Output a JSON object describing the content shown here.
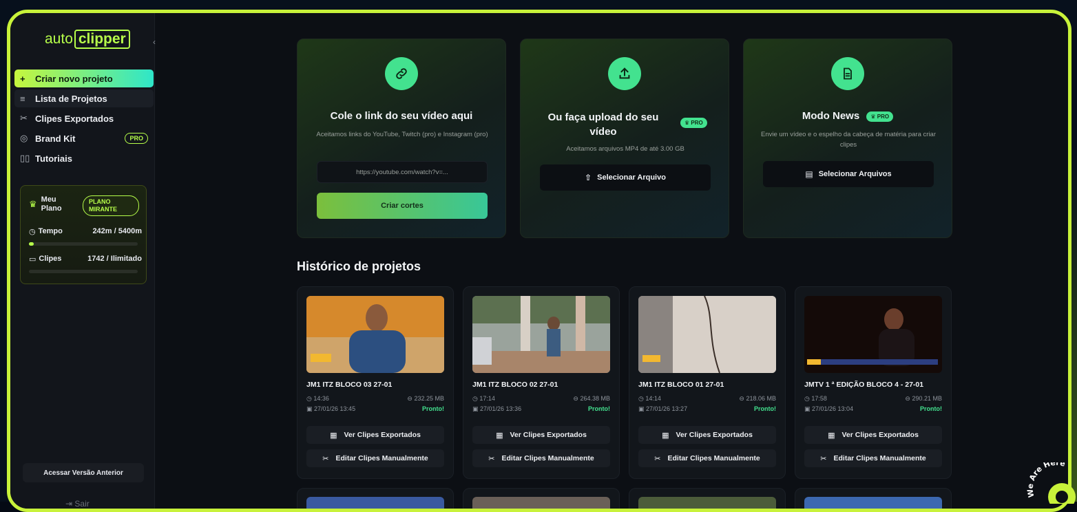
{
  "brand": {
    "logo_left": "auto",
    "logo_right": "clipper"
  },
  "sidebar": {
    "items": [
      {
        "icon": "plus-icon",
        "label": "Criar novo projeto"
      },
      {
        "icon": "list-icon",
        "label": "Lista de Projetos"
      },
      {
        "icon": "scissors-icon",
        "label": "Clipes Exportados"
      },
      {
        "icon": "palette-icon",
        "label": "Brand Kit",
        "badge": "PRO"
      },
      {
        "icon": "book-icon",
        "label": "Tutoriais"
      }
    ],
    "plan": {
      "label": "Meu Plano",
      "badge": "PLANO MIRANTE",
      "time_label": "Tempo",
      "time_value": "242m / 5400m",
      "time_fraction": 0.045,
      "clips_label": "Clipes",
      "clips_value": "1742 / Ilimitado",
      "clips_fraction": 0.0
    },
    "old_version": "Acessar Versão Anterior",
    "logout": "Sair"
  },
  "cards": {
    "link": {
      "title": "Cole o link do seu vídeo aqui",
      "subtitle": "Aceitamos links do YouTube, Twitch (pro) e Instagram (pro)",
      "placeholder": "https://youtube.com/watch?v=...",
      "button": "Criar cortes"
    },
    "upload": {
      "title": "Ou faça upload do seu vídeo",
      "badge": "PRO",
      "subtitle": "Aceitamos arquivos MP4 de até 3.00 GB",
      "button": "Selecionar Arquivo"
    },
    "news": {
      "title": "Modo News",
      "badge": "PRO",
      "subtitle": "Envie um vídeo e o espelho da cabeça de matéria para criar clipes",
      "button": "Selecionar Arquivos"
    }
  },
  "history": {
    "title": "Histórico de projetos",
    "projects": [
      {
        "title": "JM1 ITZ BLOCO 03 27-01",
        "duration": "14:36",
        "size": "232.25 MB",
        "date": "27/01/26 13:45",
        "status": "Pronto!",
        "btn_exported": "Ver Clipes Exportados",
        "btn_edit": "Editar Clipes Manualmente"
      },
      {
        "title": "JM1 ITZ BLOCO 02 27-01",
        "duration": "17:14",
        "size": "264.38 MB",
        "date": "27/01/26 13:36",
        "status": "Pronto!",
        "btn_exported": "Ver Clipes Exportados",
        "btn_edit": "Editar Clipes Manualmente"
      },
      {
        "title": "JM1 ITZ BLOCO 01 27-01",
        "duration": "14:14",
        "size": "218.06 MB",
        "date": "27/01/26 13:27",
        "status": "Pronto!",
        "btn_exported": "Ver Clipes Exportados",
        "btn_edit": "Editar Clipes Manualmente"
      },
      {
        "title": "JMTV 1 ª EDIÇÃO BLOCO 4 - 27-01",
        "duration": "17:58",
        "size": "290.21 MB",
        "date": "27/01/26 13:04",
        "status": "Pronto!",
        "btn_exported": "Ver Clipes Exportados",
        "btn_edit": "Editar Clipes Manualmente"
      }
    ]
  },
  "chat_widget": {
    "text": "We Are Here"
  },
  "colors": {
    "accent": "#c8f23a",
    "green": "#43e28f",
    "bg": "#0c0f14"
  }
}
